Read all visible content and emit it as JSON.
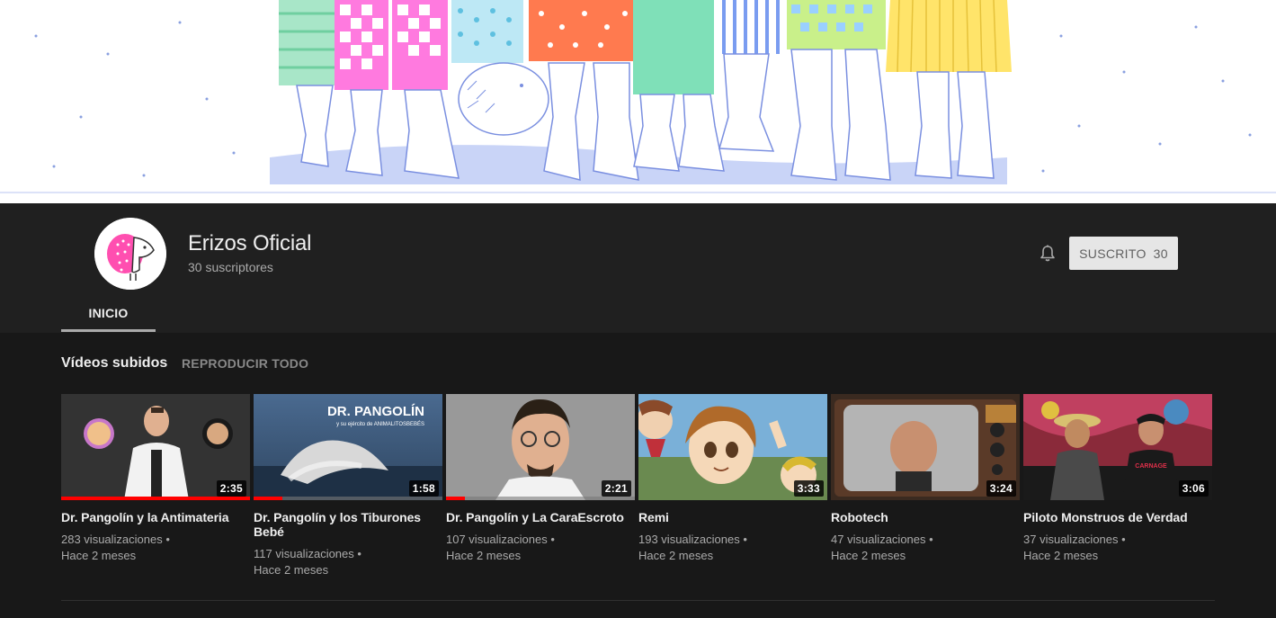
{
  "channel": {
    "name": "Erizos Oficial",
    "subscribers": "30 suscriptores",
    "subscribe_label": "SUSCRITO",
    "subscribe_count": "30"
  },
  "tabs": [
    {
      "label": "INICIO",
      "active": true
    }
  ],
  "section": {
    "title": "Vídeos subidos",
    "play_all": "REPRODUCIR TODO"
  },
  "thumb_text": {
    "v2_title": "DR. PANGOLÍN",
    "v2_subtitle": "y su ejército de ANIMALITOSBEBÉS"
  },
  "videos": [
    {
      "title": "Dr. Pangolín y la Antimateria",
      "views": "283 visualizaciones •",
      "age": "Hace 2 meses",
      "duration": "2:35",
      "watched_fraction": 1.0
    },
    {
      "title": "Dr. Pangolín y los Tiburones Bebé",
      "views": "117 visualizaciones •",
      "age": "Hace 2 meses",
      "duration": "1:58",
      "watched_fraction": 0.15
    },
    {
      "title": "Dr. Pangolín y La CaraEscroto",
      "views": "107 visualizaciones •",
      "age": "Hace 2 meses",
      "duration": "2:21",
      "watched_fraction": 0.1
    },
    {
      "title": "Remi",
      "views": "193 visualizaciones •",
      "age": "Hace 2 meses",
      "duration": "3:33",
      "watched_fraction": 0
    },
    {
      "title": "Robotech",
      "views": "47 visualizaciones •",
      "age": "Hace 2 meses",
      "duration": "3:24",
      "watched_fraction": 0
    },
    {
      "title": "Piloto Monstruos de Verdad",
      "views": "37 visualizaciones •",
      "age": "Hace 2 meses",
      "duration": "3:06",
      "watched_fraction": 0
    }
  ],
  "colors": {
    "page_bg": "#181818",
    "header_bg": "#202020",
    "progress": "#ff0000",
    "accent_pink": "#ff4fb0"
  }
}
